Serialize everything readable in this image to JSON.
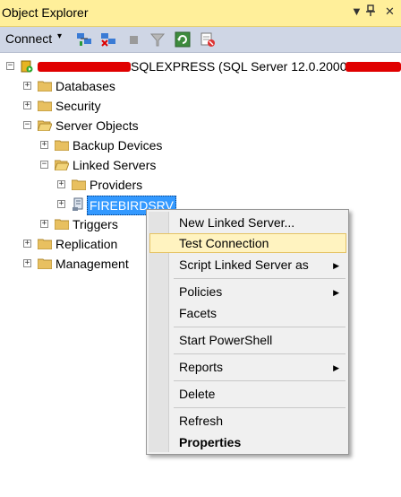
{
  "window": {
    "title": "Object Explorer",
    "controls": {
      "dropdown": "▼",
      "pin": "📌",
      "close": "✕"
    }
  },
  "toolbar": {
    "connect_label": "Connect",
    "caret": "▾"
  },
  "tree": {
    "server": {
      "label": "SQLEXPRESS (SQL Server 12.0.2000 -",
      "expander": "−"
    },
    "nodes": [
      {
        "label": "Databases",
        "expander": "+"
      },
      {
        "label": "Security",
        "expander": "+"
      },
      {
        "label": "Server Objects",
        "expander": "−"
      },
      {
        "label": "Backup Devices",
        "expander": "+"
      },
      {
        "label": "Linked Servers",
        "expander": "−"
      },
      {
        "label": "Providers",
        "expander": "+"
      },
      {
        "label": "FIREBIRDSRV",
        "expander": "+"
      },
      {
        "label": "Triggers",
        "expander": "+"
      },
      {
        "label": "Replication",
        "expander": "+"
      },
      {
        "label": "Management",
        "expander": "+"
      }
    ]
  },
  "context_menu": {
    "items": [
      {
        "label": "New Linked Server..."
      },
      {
        "label": "Test Connection"
      },
      {
        "label": "Script Linked Server as",
        "arrow": "▶"
      },
      {
        "label": "Policies",
        "arrow": "▶"
      },
      {
        "label": "Facets"
      },
      {
        "label": "Start PowerShell"
      },
      {
        "label": "Reports",
        "arrow": "▶"
      },
      {
        "label": "Delete"
      },
      {
        "label": "Refresh"
      },
      {
        "label": "Properties"
      }
    ],
    "highlighted": "Test Connection"
  },
  "colors": {
    "titlebar": "#ffef9a",
    "toolbar": "#cfd6e5",
    "selection": "#3399ff",
    "redaction": "#e00000"
  }
}
